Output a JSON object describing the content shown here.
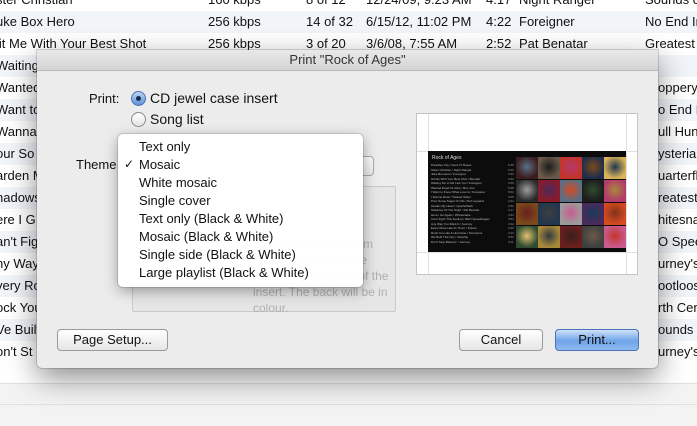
{
  "background_list": {
    "rows": [
      {
        "title": "ster Christian",
        "bitrate": "160 kbps",
        "track": "8 of 12",
        "date": "12/24/09, 9:23 AM",
        "time": "4:17",
        "artist": "Night Ranger",
        "album": "Sounds o"
      },
      {
        "title": "uke Box Hero",
        "bitrate": "256 kbps",
        "track": "14 of 32",
        "date": "6/15/12, 11:02 PM",
        "time": "4:22",
        "artist": "Foreigner",
        "album": "No End In"
      },
      {
        "title": "lit Me With Your Best Shot",
        "bitrate": "256 kbps",
        "track": "3 of 20",
        "date": "3/6/08, 7:55 AM",
        "time": "2:52",
        "artist": "Pat Benatar",
        "album": "Greatest H"
      }
    ],
    "left_fragments": [
      "Waiting fo",
      "Wanted I",
      "Want to",
      "Wanna",
      "our So",
      "arden M",
      "hadows",
      "ere I G",
      "an't Fig",
      "ny Way",
      "very Ro",
      "ock You",
      "Ve Built",
      "on't St"
    ],
    "right_fragments": [
      "oppery W",
      "o End In",
      "ull Hung",
      "ysteria",
      "uarterfla",
      "reatest H",
      "hitesnal",
      "O Spee",
      "urney's",
      "ootloose",
      "rth Cent",
      "ounds o",
      "urney's"
    ]
  },
  "dialog": {
    "title": "Print \"Rock of Ages\"",
    "print_label": "Print:",
    "print_options": [
      {
        "label": "CD jewel case insert",
        "checked": true
      },
      {
        "label": "Song list",
        "checked": false
      }
    ],
    "theme_label": "Theme",
    "description": "ages of multiple album covers. Tracks will be printed on the back of the insert. The back will be in colour.",
    "buttons": {
      "page_setup": "Page Setup...",
      "cancel": "Cancel",
      "print": "Print..."
    }
  },
  "theme_menu": {
    "selected": "Mosaic",
    "items": [
      {
        "label": "Text only",
        "checked": false
      },
      {
        "label": "Mosaic",
        "checked": true
      },
      {
        "label": "White mosaic",
        "checked": false
      },
      {
        "label": "Single cover",
        "checked": false
      },
      {
        "label": "Text only (Black & White)",
        "checked": false
      },
      {
        "label": "Mosaic (Black & White)",
        "checked": false
      },
      {
        "label": "Single side (Black & White)",
        "checked": false
      },
      {
        "label": "Large playlist (Black & White)",
        "checked": false
      }
    ],
    "check_glyph": "✓"
  },
  "preview": {
    "insert_title": "Rock of Ages",
    "tracks": [
      {
        "name": "Paradise City / Guns N' Roses",
        "time": "6:45"
      },
      {
        "name": "Sister Christian / Night Ranger",
        "time": "5:02"
      },
      {
        "name": "Juke Box Hero / Foreigner",
        "time": "4:22"
      },
      {
        "name": "Hit Me With Your Best Shot / Benatar",
        "time": "2:52"
      },
      {
        "name": "Waiting For A Girl Like You / Foreigner",
        "time": "4:55"
      },
      {
        "name": "Wanted Dead Or Alive / Bon Jovi",
        "time": "5:08"
      },
      {
        "name": "I Want to Know What Love Is / Foreigner",
        "time": "5:03"
      },
      {
        "name": "I Wanna Rock / Twisted Sister",
        "time": "3:05"
      },
      {
        "name": "Pour Some Sugar On Me / Def Leppard",
        "time": "4:24"
      },
      {
        "name": "Harden My Heart / Quarterflash",
        "time": "3:52"
      },
      {
        "name": "Shadows Of The Night / Pat Benatar",
        "time": "4:17"
      },
      {
        "name": "Here I Go Again / Whitesnake",
        "time": "4:34"
      },
      {
        "name": "Can't Fight This Feeling / REO Speedwagon",
        "time": "4:54"
      },
      {
        "name": "Any Way You Want It / Journey",
        "time": "3:22"
      },
      {
        "name": "Every Rose Has Its Thorn / Poison",
        "time": "4:20"
      },
      {
        "name": "Rock You Like A Hurricane / Scorpions",
        "time": "4:13"
      },
      {
        "name": "We Built This City / Starship",
        "time": "4:56"
      },
      {
        "name": "Don't Stop Believin' / Journey",
        "time": "4:11"
      }
    ]
  }
}
